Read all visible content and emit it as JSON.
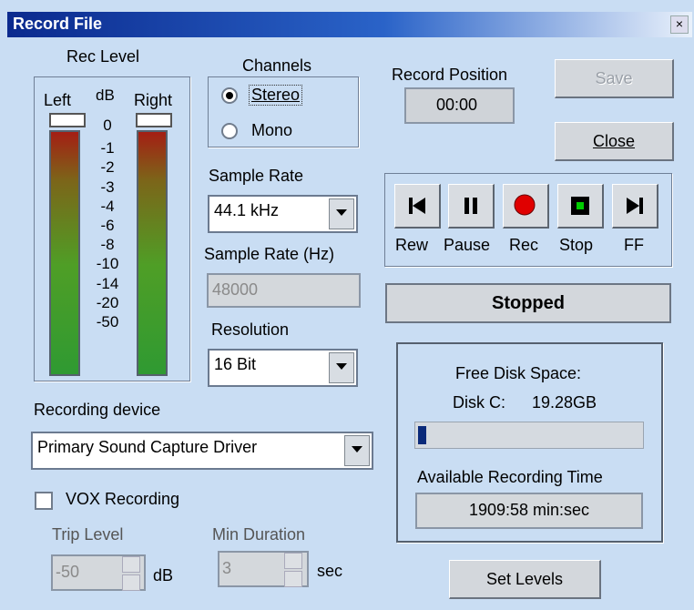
{
  "window": {
    "title": "Record File",
    "close_glyph": "×"
  },
  "rec_level": {
    "title": "Rec Level",
    "left": "Left",
    "db": "dB",
    "right": "Right",
    "scale": [
      "0",
      "-1",
      "-2",
      "-3",
      "-4",
      "-6",
      "-8",
      "-10",
      "-14",
      "-20",
      "-50"
    ]
  },
  "channels": {
    "title": "Channels",
    "stereo": "Stereo",
    "mono": "Mono",
    "selected": "Stereo"
  },
  "sample_rate": {
    "label": "Sample Rate",
    "value": "44.1 kHz",
    "hz_label": "Sample Rate (Hz)",
    "hz_value": "48000"
  },
  "resolution": {
    "label": "Resolution",
    "value": "16 Bit"
  },
  "device": {
    "label": "Recording device",
    "value": "Primary Sound Capture Driver"
  },
  "vox": {
    "label": "VOX Recording",
    "checked": false,
    "trip_label": "Trip Level",
    "trip_value": "-50",
    "trip_unit": "dB",
    "min_label": "Min Duration",
    "min_value": "3",
    "min_unit": "sec"
  },
  "position": {
    "label": "Record Position",
    "value": "00:00"
  },
  "buttons": {
    "save": "Save",
    "close": "Close",
    "set_levels": "Set Levels"
  },
  "transport": {
    "rew": "Rew",
    "pause": "Pause",
    "rec": "Rec",
    "stop": "Stop",
    "ff": "FF"
  },
  "status": "Stopped",
  "disk": {
    "title": "Free Disk Space:",
    "disk_label": "Disk C:",
    "disk_value": "19.28GB",
    "usage_fraction": 0.07,
    "time_title": "Available Recording Time",
    "time_value": "1909:58 min:sec"
  },
  "colors": {
    "dialog_bg": "#c9ddf3",
    "rec_red": "#e00000",
    "stop_green": "#00cc00",
    "disk_bar": "#0a2a7a"
  }
}
